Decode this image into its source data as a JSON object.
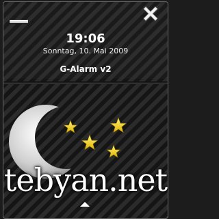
{
  "header": {
    "time": "19:06",
    "date": "Sonntag, 10. Mai 2009",
    "app_title": "G-Alarm v2"
  },
  "icons": {
    "minimize": "minimize-icon",
    "close": "close-icon",
    "moon": "moon-icon",
    "star": "star-icon",
    "handle": "up-arrow-icon"
  },
  "watermark": "tebyan.net",
  "colors": {
    "background": "#1c1c1c",
    "text": "#ffffff",
    "star": "#f6d21a",
    "moon": "#d8d8d8"
  }
}
